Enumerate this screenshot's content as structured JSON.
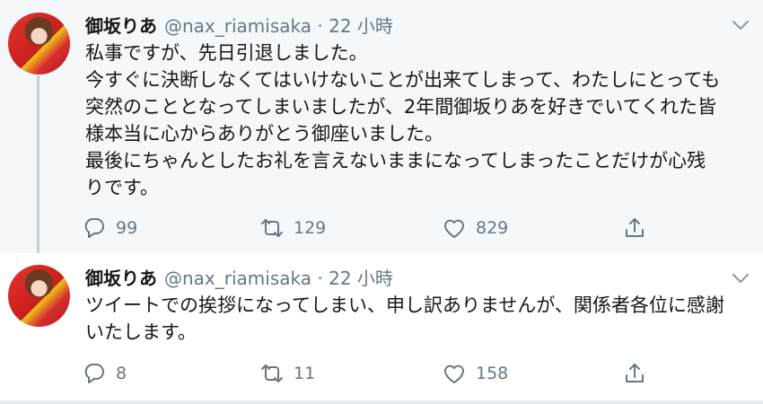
{
  "tweets": [
    {
      "name": "御坂りあ",
      "handle": "@nax_riamisaka",
      "time": "· 22 小時",
      "lines": [
        "私事ですが、先日引退しました。",
        "今すぐに決断しなくてはいけないことが出来てしまって、わたしにとっても",
        "突然のこととなってしまいましたが、2年間御坂りあを好きでいてくれた皆",
        "様本当に心からありがとう御座いました。",
        "最後にちゃんとしたお礼を言えないままになってしまったことだけが心残",
        "りです。"
      ],
      "replies": "99",
      "retweets": "129",
      "likes": "829"
    },
    {
      "name": "御坂りあ",
      "handle": "@nax_riamisaka",
      "time": "· 22 小時",
      "lines": [
        "ツイートでの挨拶になってしまい、申し訳ありませんが、関係者各位に感謝",
        "いたします。"
      ],
      "replies": "8",
      "retweets": "11",
      "likes": "158"
    }
  ],
  "icons": {
    "reply": "reply-icon",
    "retweet": "retweet-icon",
    "like": "heart-icon",
    "share": "share-icon",
    "menu": "chevron-down-icon"
  },
  "colors": {
    "thread_bg": "#f5f8fa",
    "muted": "#657786",
    "thread_line": "#c4cfd6"
  }
}
